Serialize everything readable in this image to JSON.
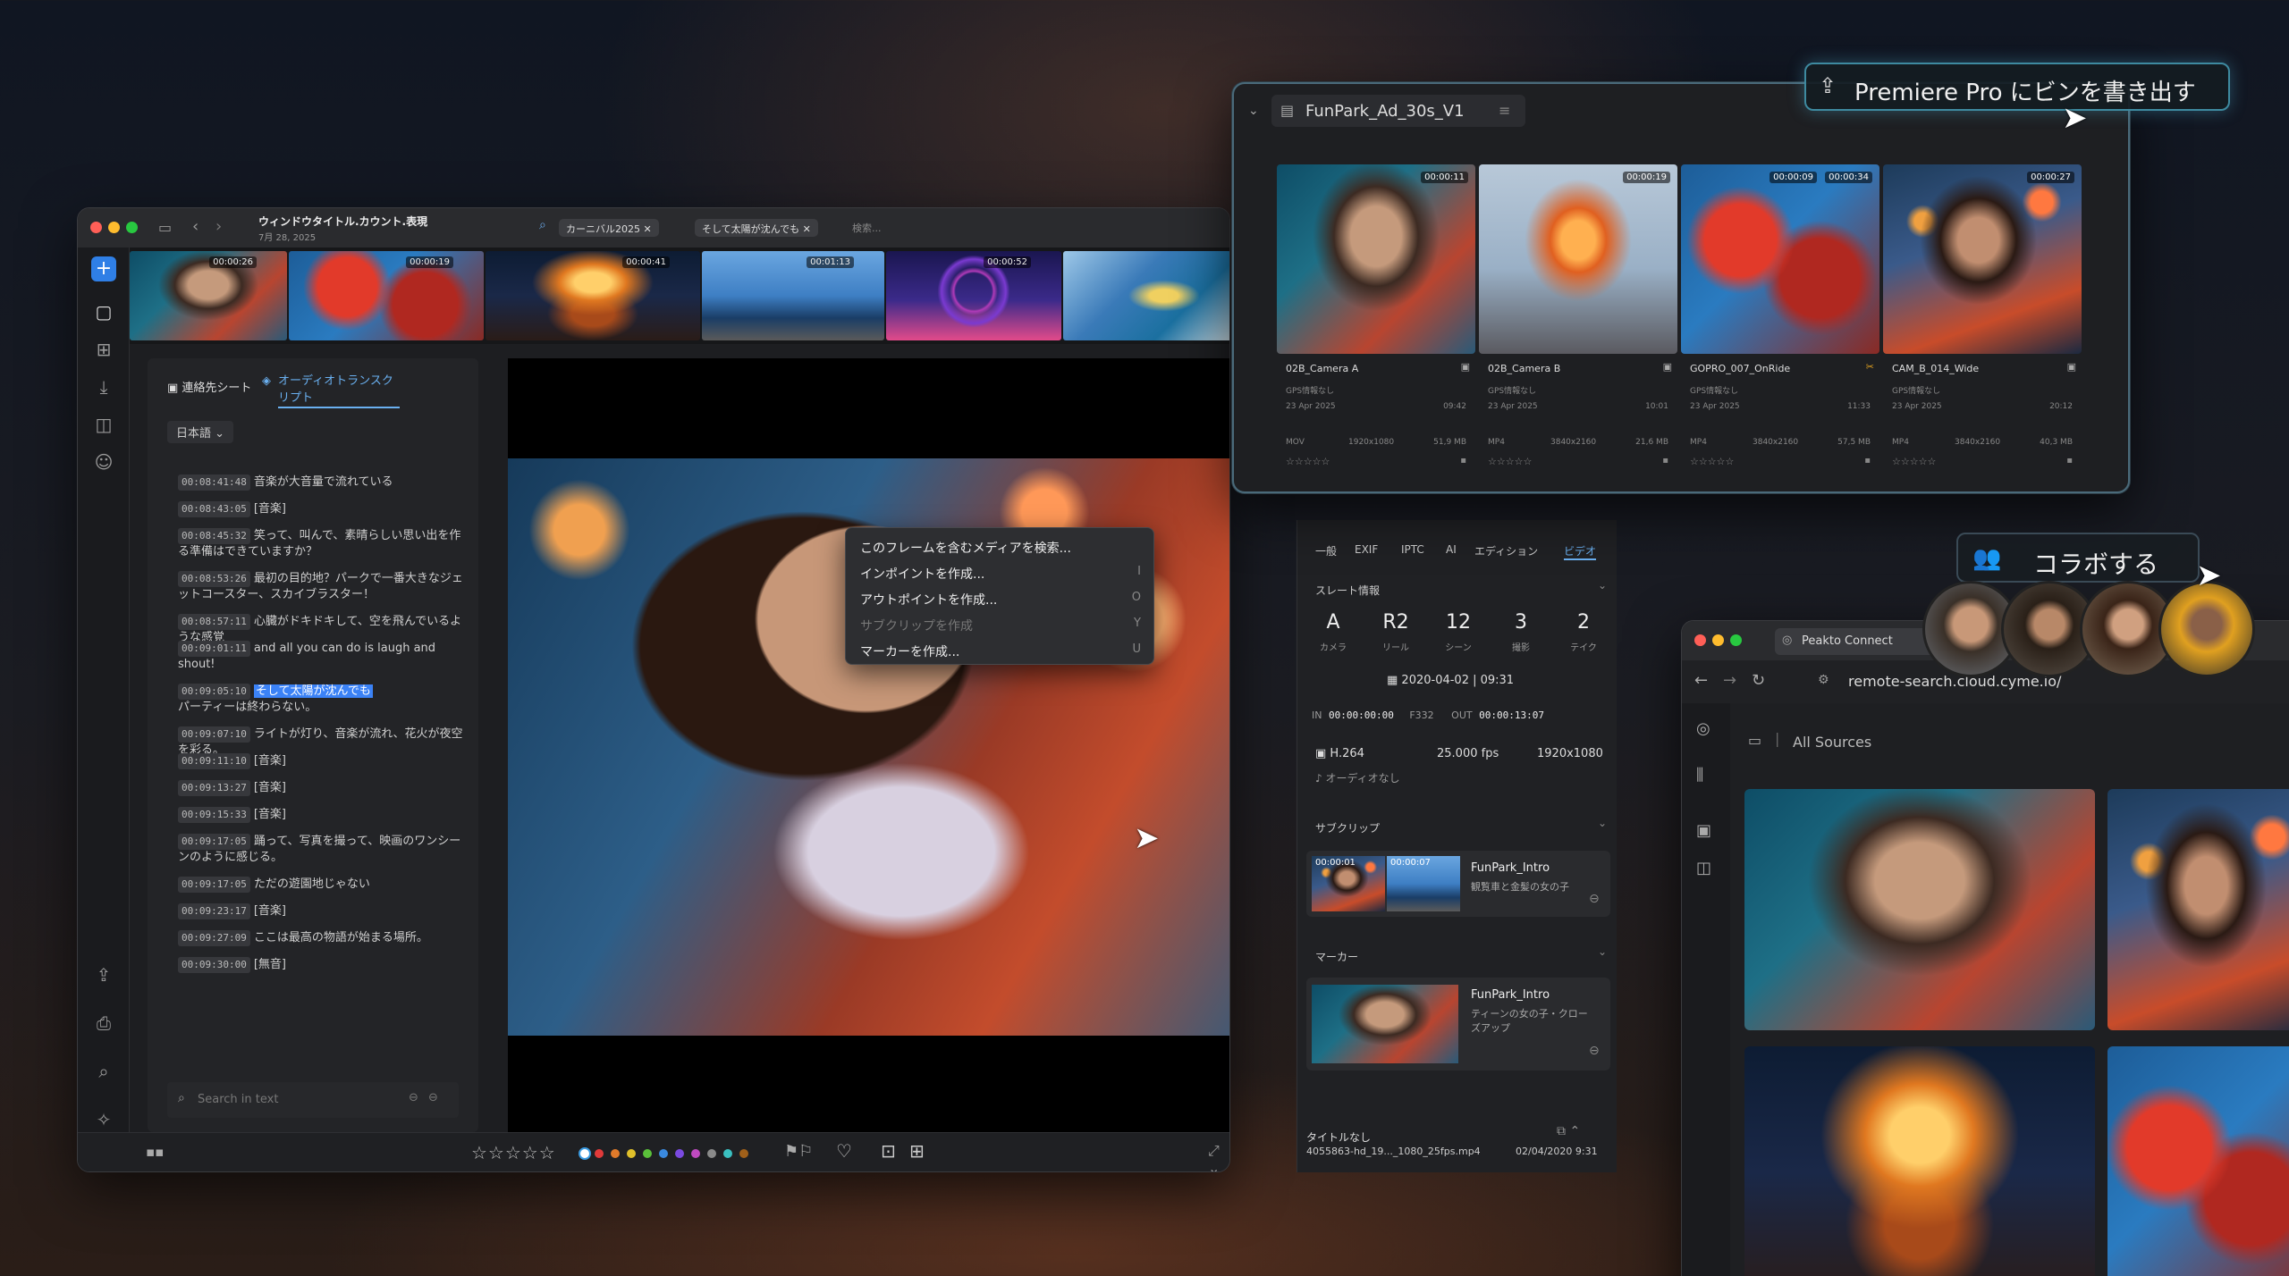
{
  "main_window": {
    "title": "ウィンドウタイトル.カウント.表現",
    "date": "7月 28, 2025",
    "search_chips": [
      "カーニバル2025",
      "そして太陽が沈んでも"
    ],
    "search_placeholder": "検索...",
    "filmstrip_timecodes": [
      "00:00:26",
      "00:00:19",
      "00:00:41",
      "00:01:13",
      "00:00:52"
    ],
    "transcript_tabs": [
      "連絡先シート",
      "オーディオトランスクリプト"
    ],
    "language": "日本語",
    "transcript": [
      {
        "time": "00:08:41:48",
        "text": "音楽が大音量で流れている"
      },
      {
        "time": "00:08:43:05",
        "text": "[音楽]"
      },
      {
        "time": "00:08:45:32",
        "text": "笑って、叫んで、素晴らしい思い出を作る準備はできていますか？"
      },
      {
        "time": "00:08:53:26",
        "text": "最初の目的地？パークで一番大きなジェットコースター、スカイブラスター！"
      },
      {
        "time": "00:08:57:11",
        "text": "心臓がドキドキして、空を飛んでいるような感覚"
      },
      {
        "time": "00:09:01:11",
        "text": "and all you can do is laugh and shout!"
      },
      {
        "time": "00:09:05:10",
        "highlight": "そして太陽が沈んでも",
        "text": "パーティーは終わらない。"
      },
      {
        "time": "00:09:07:10",
        "text": "ライトが灯り、音楽が流れ、花火が夜空を彩る。"
      },
      {
        "time": "00:09:11:10",
        "text": "[音楽]"
      },
      {
        "time": "00:09:13:27",
        "text": "[音楽]"
      },
      {
        "time": "00:09:15:33",
        "text": "[音楽]"
      },
      {
        "time": "00:09:17:05",
        "text": "踊って、写真を撮って、映画のワンシーンのように感じる。"
      },
      {
        "time": "00:09:17:05",
        "text": "ただの遊園地じゃない"
      },
      {
        "time": "00:09:23:17",
        "text": "[音楽]"
      },
      {
        "time": "00:09:27:09",
        "text": "ここは最高の物語が始まる場所。"
      },
      {
        "time": "00:09:30:00",
        "text": "[無音]"
      }
    ],
    "search_in_text": "Search in text",
    "context_menu": [
      {
        "label": "このフレームを含むメディアを検索...",
        "key": "",
        "disabled": false
      },
      {
        "label": "インポイントを作成...",
        "key": "I",
        "disabled": false
      },
      {
        "label": "アウトポイントを作成...",
        "key": "O",
        "disabled": false
      },
      {
        "label": "サブクリップを作成",
        "key": "Y",
        "disabled": true
      },
      {
        "label": "マーカーを作成...",
        "key": "U",
        "disabled": false
      }
    ],
    "rating": "☆☆☆☆☆",
    "color_labels": [
      "#ffffff",
      "#e03a3a",
      "#e07a2a",
      "#e0c02a",
      "#5ac03a",
      "#3a8ae0",
      "#7a4ae0",
      "#c04ac0",
      "#8a8a8a",
      "#3ac0c0",
      "#a0601a"
    ]
  },
  "inspector": {
    "tabs": [
      "一般",
      "EXIF",
      "IPTC",
      "AI",
      "エディション",
      "ビデオ"
    ],
    "active_tab": "ビデオ",
    "slate_title": "スレート情報",
    "slate": [
      {
        "value": "A",
        "label": "カメラ"
      },
      {
        "value": "R2",
        "label": "リール"
      },
      {
        "value": "12",
        "label": "シーン"
      },
      {
        "value": "3",
        "label": "撮影"
      },
      {
        "value": "2",
        "label": "テイク"
      }
    ],
    "datetime": "2020-04-02 | 09:31",
    "in_label": "IN",
    "in_tc": "00:00:00:00",
    "frames": "F332",
    "out_label": "OUT",
    "out_tc": "00:00:13:07",
    "codec": "H.264",
    "fps": "25.000 fps",
    "resolution": "1920x1080",
    "audio": "オーディオなし",
    "subclip_title": "サブクリップ",
    "subclip_in": "00:00:01",
    "subclip_out": "00:00:07",
    "subclip_name": "FunPark_Intro",
    "subclip_desc": "観覧車と金髪の女の子",
    "marker_title": "マーカー",
    "marker_name": "FunPark_Intro",
    "marker_desc": "ティーンの女の子・クローズアップ",
    "footer_title": "タイトルなし",
    "footer_file": "4055863-hd_19..._1080_25fps.mp4",
    "footer_date": "02/04/2020 9:31"
  },
  "bin_window": {
    "name": "FunPark_Ad_30s_V1",
    "clips": [
      {
        "name": "02B_Camera A",
        "tc": "00:00:11",
        "date": "23 Apr 2025",
        "time": "09:42",
        "format": "MOV",
        "res": "1920x1080",
        "size": "51,9 MB",
        "gps": "GPS情報なし"
      },
      {
        "name": "02B_Camera B",
        "tc": "00:00:19",
        "date": "23 Apr 2025",
        "time": "10:01",
        "format": "MP4",
        "res": "3840x2160",
        "size": "21,6 MB",
        "gps": "GPS情報なし"
      },
      {
        "name": "GOPRO_007_OnRide",
        "tc": "00:00:34",
        "tc2": "00:00:09",
        "date": "23 Apr 2025",
        "time": "11:33",
        "format": "MP4",
        "res": "3840x2160",
        "size": "57,5 MB",
        "gps": "GPS情報なし"
      },
      {
        "name": "CAM_B_014_Wide",
        "tc": "00:00:27",
        "date": "23 Apr 2025",
        "time": "20:12",
        "format": "MP4",
        "res": "3840x2160",
        "size": "40,3 MB",
        "gps": "GPS情報なし"
      }
    ],
    "rating": "☆☆☆☆☆"
  },
  "export_callout": "Premiere Pro にビンを書き出す",
  "collab_callout": "コラボする",
  "connect_window": {
    "title": "Peakto Connect",
    "url": "remote-search.cloud.cyme.io/",
    "sources": "All Sources"
  }
}
